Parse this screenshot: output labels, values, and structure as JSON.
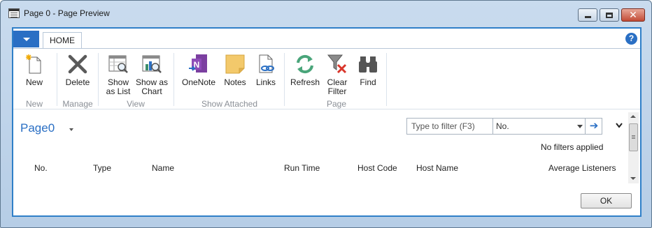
{
  "window": {
    "title": "Page 0 - Page Preview",
    "controls": [
      "minimize",
      "maximize",
      "close"
    ]
  },
  "ribbon": {
    "tabs": [
      {
        "label": "HOME",
        "selected": true
      }
    ],
    "groups": [
      {
        "label": "New",
        "buttons": [
          {
            "label": "New",
            "icon": "new-document-icon"
          }
        ]
      },
      {
        "label": "Manage",
        "buttons": [
          {
            "label": "Delete",
            "icon": "delete-x-icon"
          }
        ]
      },
      {
        "label": "View",
        "buttons": [
          {
            "label_line1": "Show",
            "label_line2": "as List",
            "icon": "list-magnify-icon"
          },
          {
            "label_line1": "Show as",
            "label_line2": "Chart",
            "icon": "chart-magnify-icon"
          }
        ]
      },
      {
        "label": "Show Attached",
        "buttons": [
          {
            "label": "OneNote",
            "icon": "onenote-icon"
          },
          {
            "label": "Notes",
            "icon": "sticky-note-icon"
          },
          {
            "label": "Links",
            "icon": "link-document-icon"
          }
        ]
      },
      {
        "label": "Page",
        "buttons": [
          {
            "label": "Refresh",
            "icon": "refresh-icon"
          },
          {
            "label_line1": "Clear",
            "label_line2": "Filter",
            "icon": "clear-filter-icon"
          },
          {
            "label": "Find",
            "icon": "binoculars-icon"
          }
        ]
      }
    ]
  },
  "page": {
    "title": "Page0",
    "filter": {
      "placeholder": "Type to filter (F3)",
      "field": "No."
    },
    "filter_status": "No filters applied",
    "columns": [
      "No.",
      "Type",
      "Name",
      "Run Time",
      "Host Code",
      "Host Name",
      "Average Listeners"
    ]
  },
  "footer": {
    "ok_label": "OK"
  },
  "colors": {
    "accent": "#2a6fc4",
    "frame": "#c9dbee",
    "group_label": "#8a8f96"
  }
}
